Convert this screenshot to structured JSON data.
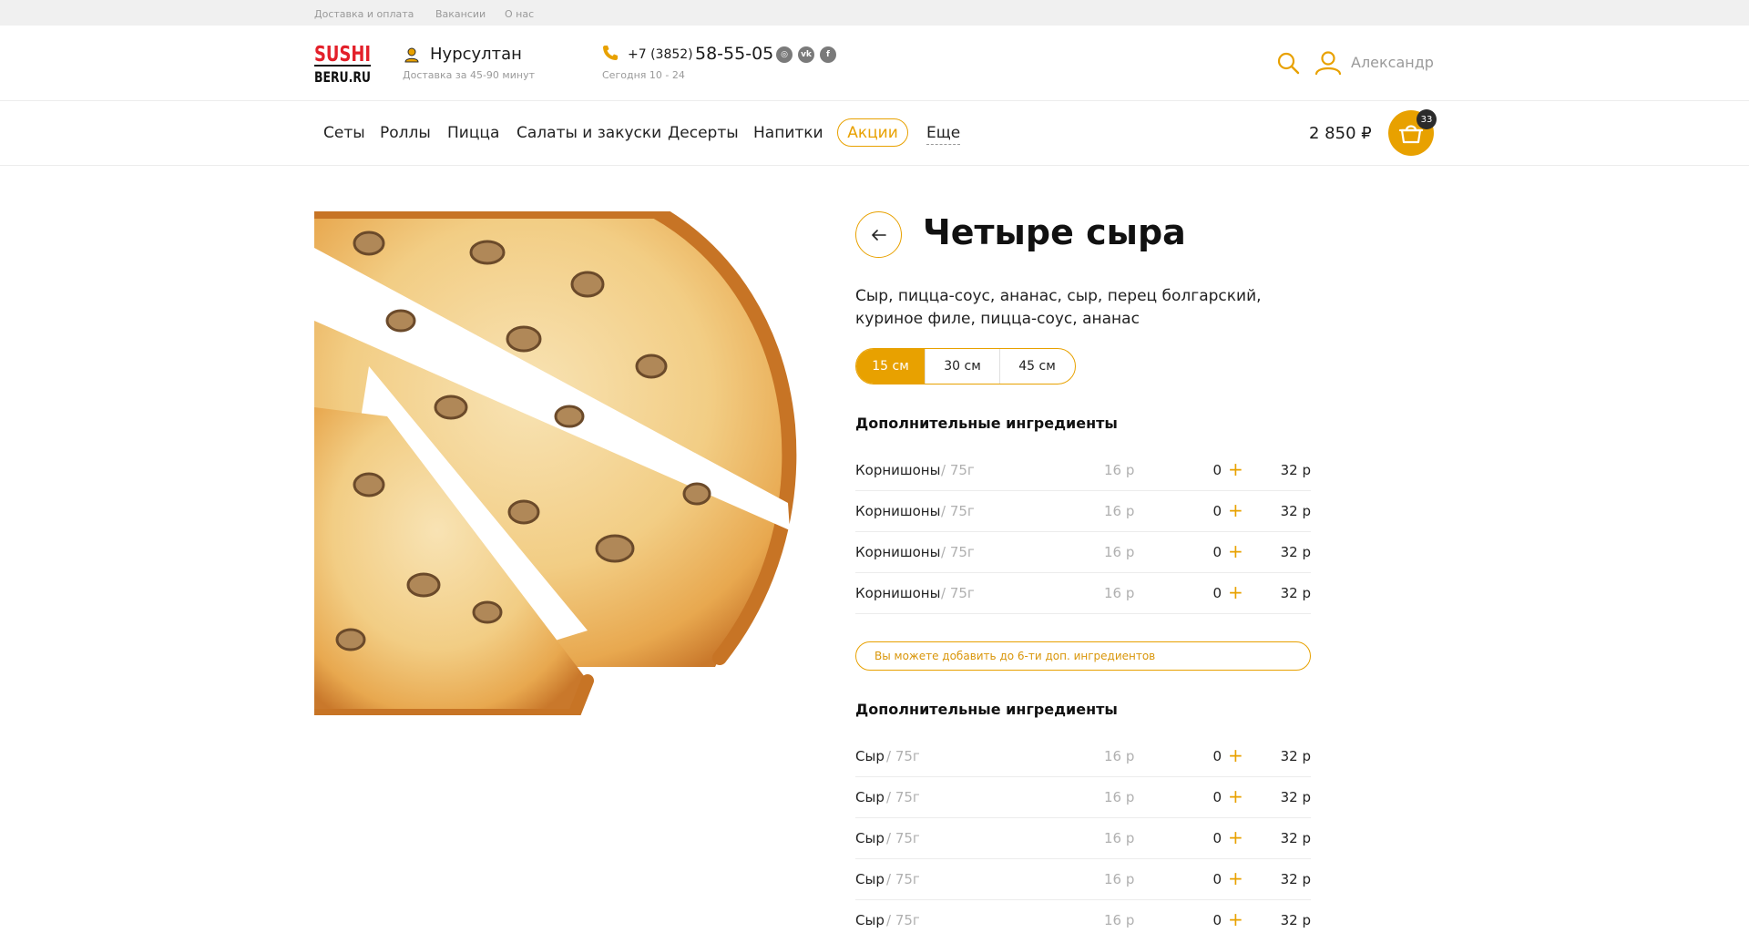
{
  "topbar": {
    "links": [
      "Доставка и оплата",
      "Вакансии",
      "О нас"
    ]
  },
  "header": {
    "logo": {
      "line1": "SUSHI",
      "line2": "BERU.RU"
    },
    "city": "Нурсултан",
    "delivery_time": "Доставка за 45-90 минут",
    "phone_prefix": "+7 (3852)",
    "phone_number": "58-55-05",
    "hours": "Сегодня 10 - 24",
    "social_icons": [
      "instagram-icon",
      "vk-icon",
      "facebook-icon"
    ],
    "user_name": "Александр"
  },
  "nav": {
    "items": [
      "Сеты",
      "Роллы",
      "Пицца",
      "Салаты и закуски",
      "Десерты",
      "Напитки"
    ],
    "promo": "Акции",
    "more": "Еще",
    "cart_total": "2 850 ₽",
    "cart_count": "33"
  },
  "product": {
    "title": "Четыре сыра",
    "description": "Сыр, пицца-соус, ананас, сыр, перец болгарский, куриное филе, пицца-соус, ананас",
    "sizes": [
      "15 см",
      "30 см",
      "45 см"
    ],
    "selected_size": "15 см"
  },
  "extras": [
    {
      "title": "Дополнительные ингредиенты",
      "items": [
        {
          "name": "Корнишоны",
          "weight": "/ 75г",
          "price": "16 р",
          "qty": "0",
          "total": "32 р"
        },
        {
          "name": "Корнишоны",
          "weight": "/ 75г",
          "price": "16 р",
          "qty": "0",
          "total": "32 р"
        },
        {
          "name": "Корнишоны",
          "weight": "/ 75г",
          "price": "16 р",
          "qty": "0",
          "total": "32 р"
        },
        {
          "name": "Корнишоны",
          "weight": "/ 75г",
          "price": "16 р",
          "qty": "0",
          "total": "32 р"
        }
      ]
    },
    {
      "title": "Дополнительные ингредиенты",
      "items": [
        {
          "name": "Сыр",
          "weight": "/ 75г",
          "price": "16 р",
          "qty": "0",
          "total": "32 р"
        },
        {
          "name": "Сыр",
          "weight": "/ 75г",
          "price": "16 р",
          "qty": "0",
          "total": "32 р"
        },
        {
          "name": "Сыр",
          "weight": "/ 75г",
          "price": "16 р",
          "qty": "0",
          "total": "32 р"
        },
        {
          "name": "Сыр",
          "weight": "/ 75г",
          "price": "16 р",
          "qty": "0",
          "total": "32 р"
        },
        {
          "name": "Сыр",
          "weight": "/ 75г",
          "price": "16 р",
          "qty": "0",
          "total": "32 р"
        }
      ]
    }
  ],
  "extras_notice": "Вы можете добавить до 6-ти доп. ингредиентов",
  "colors": {
    "accent": "#e8a100",
    "brand_red": "#e3202a",
    "muted": "#9a9a9a"
  }
}
